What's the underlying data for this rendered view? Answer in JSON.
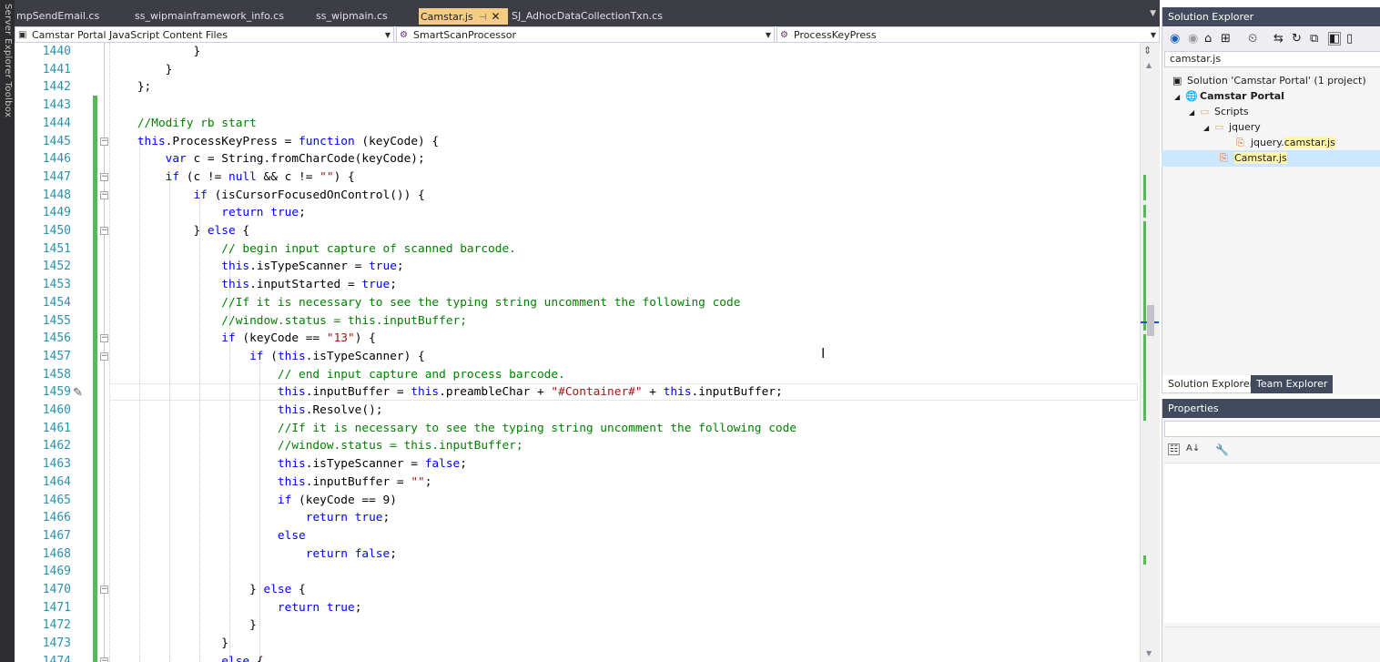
{
  "left_strip": {
    "label": "Server Explorer  Toolbox"
  },
  "tabs": [
    {
      "label": "mpSendEmail.cs",
      "active": false
    },
    {
      "label": "ss_wipmainframework_info.cs",
      "active": false
    },
    {
      "label": "ss_wipmain.cs",
      "active": false
    },
    {
      "label": "Camstar.js",
      "active": true
    },
    {
      "label": "SJ_AdhocDataCollectionTxn.cs",
      "active": false
    }
  ],
  "navbar": {
    "project": "Camstar Portal JavaScript Content Files",
    "type": "SmartScanProcessor",
    "member": "ProcessKeyPress"
  },
  "editor": {
    "lines": [
      {
        "n": "1440",
        "html": "            }"
      },
      {
        "n": "1441",
        "html": "        }"
      },
      {
        "n": "1442",
        "html": "    };"
      },
      {
        "n": "1443",
        "html": ""
      },
      {
        "n": "1444",
        "html": "    <span class=\"cm\">//Modify rb start</span>"
      },
      {
        "n": "1445",
        "html": "    <span class=\"kw\">this</span>.ProcessKeyPress = <span class=\"kw\">function</span> (keyCode) {"
      },
      {
        "n": "1446",
        "html": "        <span class=\"kw\">var</span> c = String.fromCharCode(keyCode);"
      },
      {
        "n": "1447",
        "html": "        <span class=\"kw\">if</span> (c != <span class=\"kw\">null</span> &amp;&amp; c != <span class=\"st\">\"\"</span>) {"
      },
      {
        "n": "1448",
        "html": "            <span class=\"kw\">if</span> (isCursorFocusedOnControl()) {"
      },
      {
        "n": "1449",
        "html": "                <span class=\"kw\">return</span> <span class=\"kw\">true</span>;"
      },
      {
        "n": "1450",
        "html": "            } <span class=\"kw\">else</span> {"
      },
      {
        "n": "1451",
        "html": "                <span class=\"cm\">// begin input capture of scanned barcode.</span>"
      },
      {
        "n": "1452",
        "html": "                <span class=\"kw\">this</span>.isTypeScanner = <span class=\"kw\">true</span>;"
      },
      {
        "n": "1453",
        "html": "                <span class=\"kw\">this</span>.inputStarted = <span class=\"kw\">true</span>;"
      },
      {
        "n": "1454",
        "html": "                <span class=\"cm\">//If it is necessary to see the typing string uncomment the following code</span>"
      },
      {
        "n": "1455",
        "html": "                <span class=\"cm\">//window.status = this.inputBuffer;</span>"
      },
      {
        "n": "1456",
        "html": "                <span class=\"kw\">if</span> (keyCode == <span class=\"st\">\"13\"</span>) {"
      },
      {
        "n": "1457",
        "html": "                    <span class=\"kw\">if</span> (<span class=\"kw\">this</span>.isTypeScanner) {"
      },
      {
        "n": "1458",
        "html": "                        <span class=\"cm\">// end input capture and process barcode.</span>"
      },
      {
        "n": "1459",
        "html": "                        <span class=\"kw\">this</span>.inputBuffer = <span class=\"kw\">this</span>.preambleChar + <span class=\"st\">\"#Container#\"</span> + <span class=\"kw\">this</span>.inputBuffer;"
      },
      {
        "n": "1460",
        "html": "                        <span class=\"kw\">this</span>.Resolve();"
      },
      {
        "n": "1461",
        "html": "                        <span class=\"cm\">//If it is necessary to see the typing string uncomment the following code</span>"
      },
      {
        "n": "1462",
        "html": "                        <span class=\"cm\">//window.status = this.inputBuffer;</span>"
      },
      {
        "n": "1463",
        "html": "                        <span class=\"kw\">this</span>.isTypeScanner = <span class=\"kw\">false</span>;"
      },
      {
        "n": "1464",
        "html": "                        <span class=\"kw\">this</span>.inputBuffer = <span class=\"st\">\"\"</span>;"
      },
      {
        "n": "1465",
        "html": "                        <span class=\"kw\">if</span> (keyCode == 9)"
      },
      {
        "n": "1466",
        "html": "                            <span class=\"kw\">return</span> <span class=\"kw\">true</span>;"
      },
      {
        "n": "1467",
        "html": "                        <span class=\"kw\">else</span>"
      },
      {
        "n": "1468",
        "html": "                            <span class=\"kw\">return</span> <span class=\"kw\">false</span>;"
      },
      {
        "n": "1469",
        "html": ""
      },
      {
        "n": "1470",
        "html": "                    } <span class=\"kw\">else</span> {"
      },
      {
        "n": "1471",
        "html": "                        <span class=\"kw\">return</span> <span class=\"kw\">true</span>;"
      },
      {
        "n": "1472",
        "html": "                    }"
      },
      {
        "n": "1473",
        "html": "                }"
      },
      {
        "n": "1474",
        "html": "                <span class=\"kw\">else</span> {"
      }
    ],
    "fold_lines": [
      "1445",
      "1447",
      "1448",
      "1450",
      "1456",
      "1457",
      "1470",
      "1474"
    ]
  },
  "solution_explorer": {
    "title": "Solution Explorer",
    "search_value": "camstar.js",
    "tree": {
      "solution": "Solution 'Camstar Portal' (1 project)",
      "project": "Camstar Portal",
      "folder_scripts": "Scripts",
      "folder_jquery": "jquery",
      "file1_prefix": "jquery.",
      "file1_match": "camstar.js",
      "file2_match": "Camstar.js"
    },
    "tab_solution": "Solution Explorer",
    "tab_team": "Team Explorer"
  },
  "properties": {
    "title": "Properties"
  },
  "colors": {
    "keyword": "#0000ff",
    "comment": "#008000",
    "string": "#a31515",
    "line_number": "#2b91af",
    "active_tab": "#f5cc84",
    "change_bar": "#57b85a"
  }
}
